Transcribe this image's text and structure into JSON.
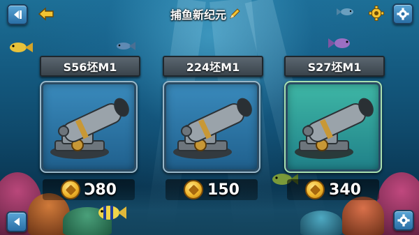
{
  "header": {
    "title": "捕鱼新纪元"
  },
  "icons": {
    "top_left_1": "pause-icon",
    "top_left_2": "back-arrow-icon",
    "title_decoration": "pencil-icon",
    "top_right_1": "gear-icon",
    "top_right_2": "settings-icon",
    "bottom_left": "left-arrow-icon",
    "bottom_right": "gear-icon"
  },
  "cannons": [
    {
      "name": "S56坯M1",
      "price": "Ͻ80",
      "selected": false
    },
    {
      "name": "224坯M1",
      "price": "150",
      "selected": false
    },
    {
      "name": "S27坯M1",
      "price": "340",
      "selected": true
    }
  ],
  "colors": {
    "ocean": "#145a80",
    "coin": "#f0b52a",
    "selected_frame": "#3fb8a6",
    "button": "#3f8bc2"
  }
}
